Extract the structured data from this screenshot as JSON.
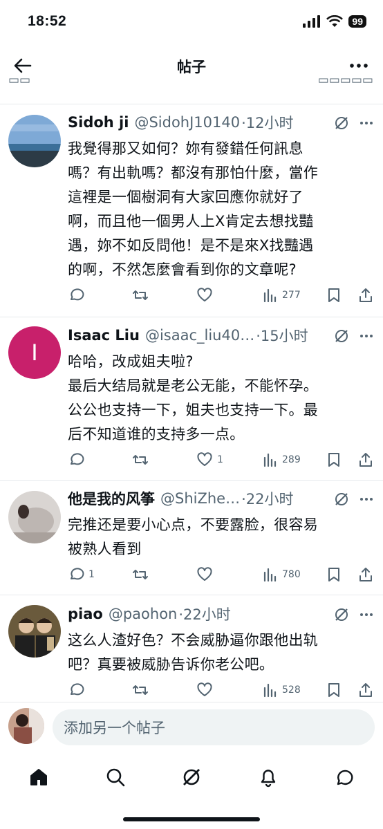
{
  "status_bar": {
    "time": "18:52",
    "battery": "99"
  },
  "nav": {
    "title": "帖子"
  },
  "posts": [
    {
      "author": "Sidoh ji",
      "handle": "@SidohJ10140",
      "time": "·12小时",
      "lines": [
        "我覺得那又如何？妳有發錯任何訊息",
        "嗎？有出軌嗎？都沒有那怕什麼，當作",
        "這裡是一個樹洞有大家回應你就好了",
        "啊，而且他一個男人上X肯定去想找豔",
        "遇，妳不如反問他！是不是來X找豔遇",
        "的啊，不然怎麼會看到你的文章呢?"
      ],
      "replies": "",
      "reposts": "",
      "likes": "",
      "views": "277"
    },
    {
      "author": "Isaac Liu",
      "handle": "@isaac_liu40…",
      "time": "·15小时",
      "avatar_letter": "I",
      "lines": [
        "哈哈，改成姐夫啦?",
        "最后大结局就是老公无能，不能怀孕。",
        "公公也支持一下，姐夫也支持一下。最",
        "后不知道谁的支持多一点。"
      ],
      "replies": "",
      "reposts": "",
      "likes": "1",
      "views": "289"
    },
    {
      "author": "他是我的风筝",
      "handle": "@ShiZhe…",
      "time": "·22小时",
      "lines": [
        "完推还是要小心点，不要露脸，很容易",
        "被熟人看到"
      ],
      "replies": "1",
      "reposts": "",
      "likes": "",
      "views": "780"
    },
    {
      "author": "piao",
      "handle": "@paohon",
      "time": "·22小时",
      "lines": [
        "这么人渣好色？不会威胁逼你跟他出轨",
        "吧？真要被威胁告诉你老公吧。"
      ],
      "replies": "",
      "reposts": "",
      "likes": "",
      "views": "528"
    }
  ],
  "reply_bar": {
    "placeholder": "添加另一个帖子"
  },
  "colors": {
    "accent": "#1d9bf0",
    "text": "#0f1419",
    "secondary": "#536471",
    "avatar_isaac": "#c8206b"
  },
  "icons": [
    "back-arrow-icon",
    "more-icon",
    "grok-icon",
    "reply-icon",
    "repost-icon",
    "like-icon",
    "views-icon",
    "bookmark-icon",
    "share-icon",
    "home-icon",
    "search-icon",
    "notifications-icon",
    "messages-icon"
  ]
}
